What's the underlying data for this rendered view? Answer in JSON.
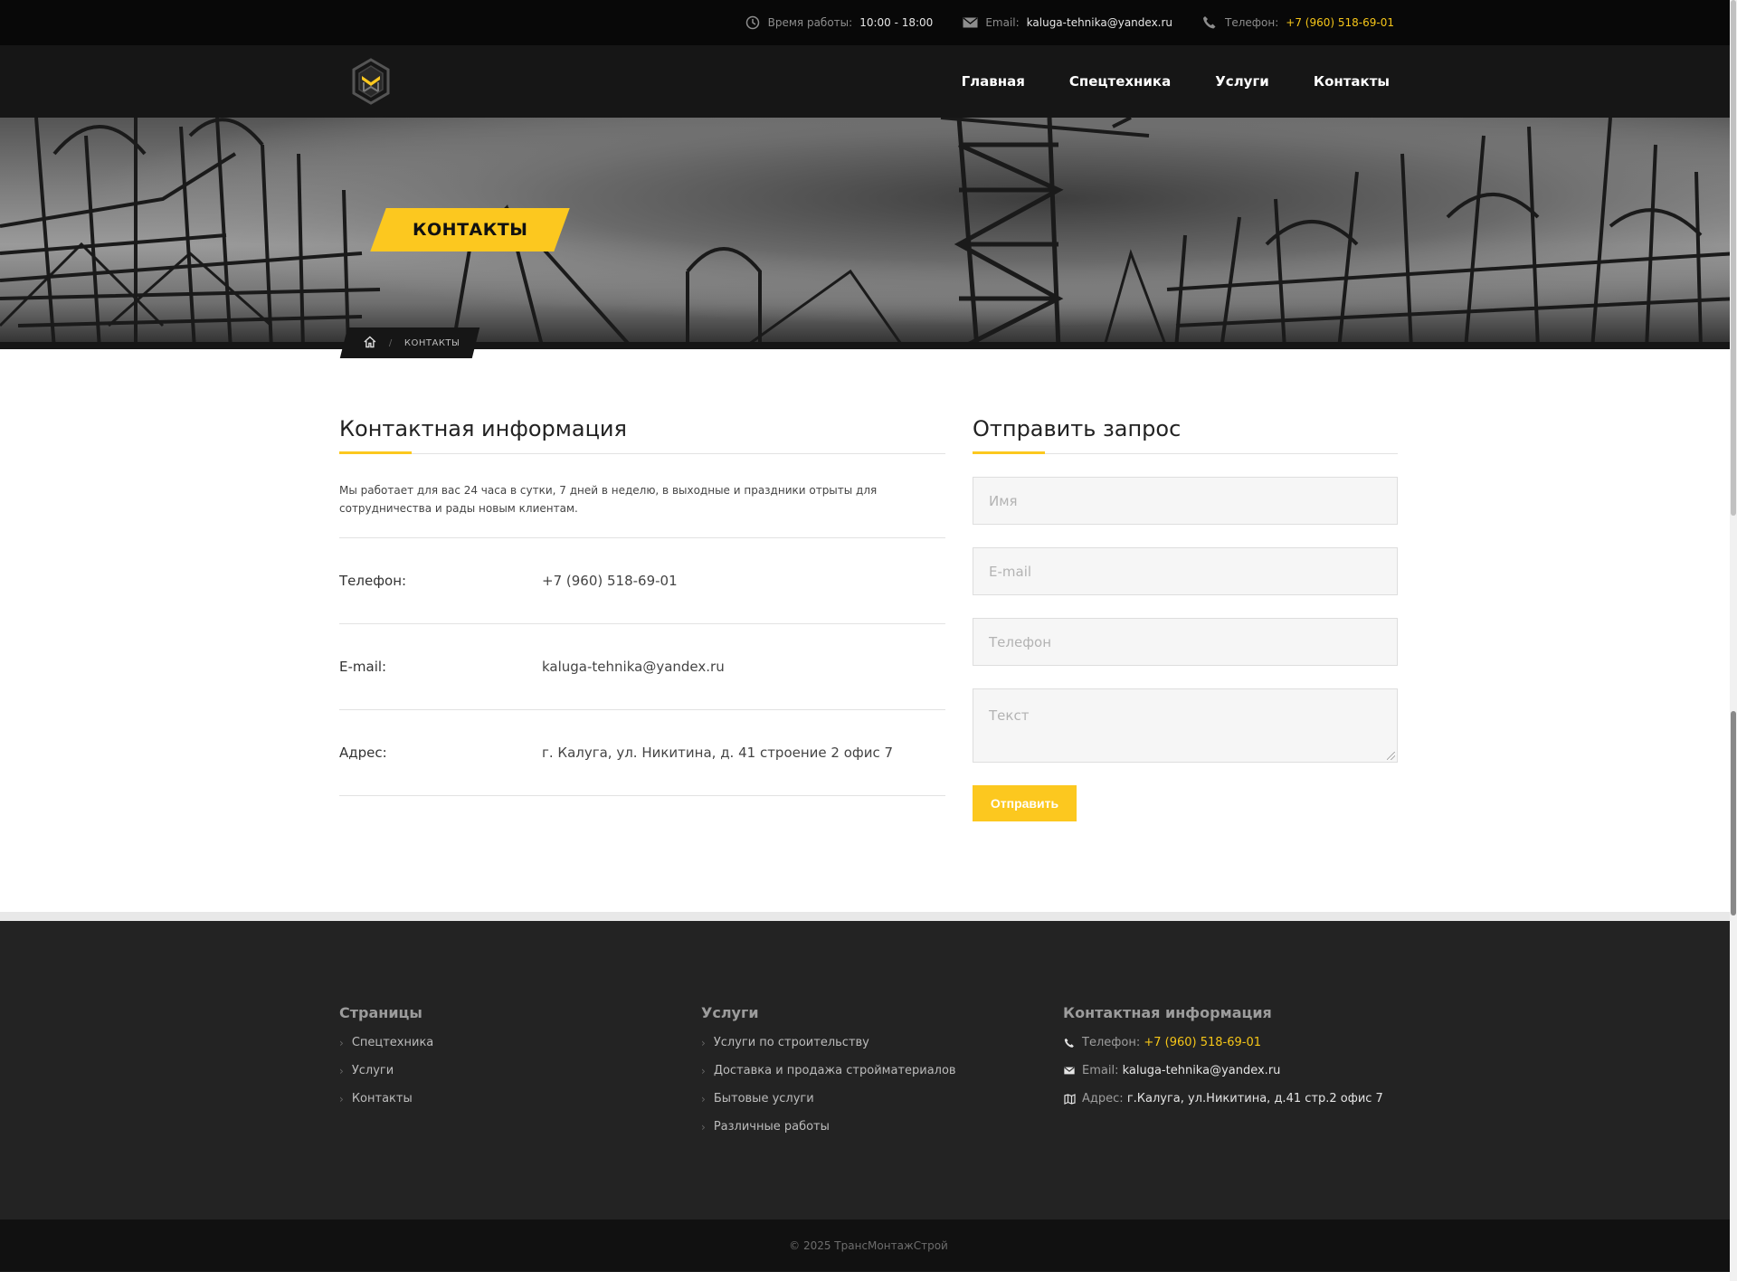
{
  "topbar": {
    "hours_label": "Время работы:",
    "hours_value": "10:00 - 18:00",
    "email_label": "Email:",
    "email_value": "kaluga-tehnika@yandex.ru",
    "phone_label": "Телефон:",
    "phone_value": "+7 (960) 518-69-01"
  },
  "nav": {
    "items": [
      "Главная",
      "Спецтехника",
      "Услуги",
      "Контакты"
    ]
  },
  "hero": {
    "title": "КОНТАКТЫ",
    "breadcrumb_current": "КОНТАКТЫ",
    "breadcrumb_sep": "/"
  },
  "contact_info": {
    "heading": "Контактная информация",
    "intro": "Мы работает для вас 24 часа в сутки, 7 дней в неделю, в выходные и праздники отрыты для сотрудничества и рады новым клиентам.",
    "rows": [
      {
        "label": "Телефон:",
        "value": "+7 (960) 518-69-01"
      },
      {
        "label": "E-mail:",
        "value": "kaluga-tehnika@yandex.ru"
      },
      {
        "label": "Адрес:",
        "value": "г. Калуга, ул. Никитина, д. 41 строение 2 офис 7"
      }
    ]
  },
  "request_form": {
    "heading": "Отправить запрос",
    "name_placeholder": "Имя",
    "email_placeholder": "E-mail",
    "phone_placeholder": "Телефон",
    "text_placeholder": "Текст",
    "submit_label": "Отправить"
  },
  "footer": {
    "pages_heading": "Страницы",
    "pages": [
      "Спецтехника",
      "Услуги",
      "Контакты"
    ],
    "services_heading": "Услуги",
    "services": [
      "Услуги по строительству",
      "Доставка и продажа стройматериалов",
      "Бытовые услуги",
      "Различные работы"
    ],
    "contacts_heading": "Контактная информация",
    "phone_label": "Телефон:",
    "phone_value": "+7 (960) 518-69-01",
    "email_label": "Email:",
    "email_value": "kaluga-tehnika@yandex.ru",
    "address_label": "Адрес:",
    "address_value": "г.Калуга, ул.Никитина, д.41 стр.2 офис 7",
    "copyright": "© 2025 ТрансМонтажСтрой"
  },
  "colors": {
    "accent": "#fcc81f",
    "dark": "#161616",
    "footer_bg": "#232323"
  },
  "icons": {
    "clock": "clock-icon",
    "mail": "mail-icon",
    "phone": "phone-icon",
    "home": "home-icon",
    "map": "map-icon",
    "chevron": "chevron-right-icon"
  }
}
